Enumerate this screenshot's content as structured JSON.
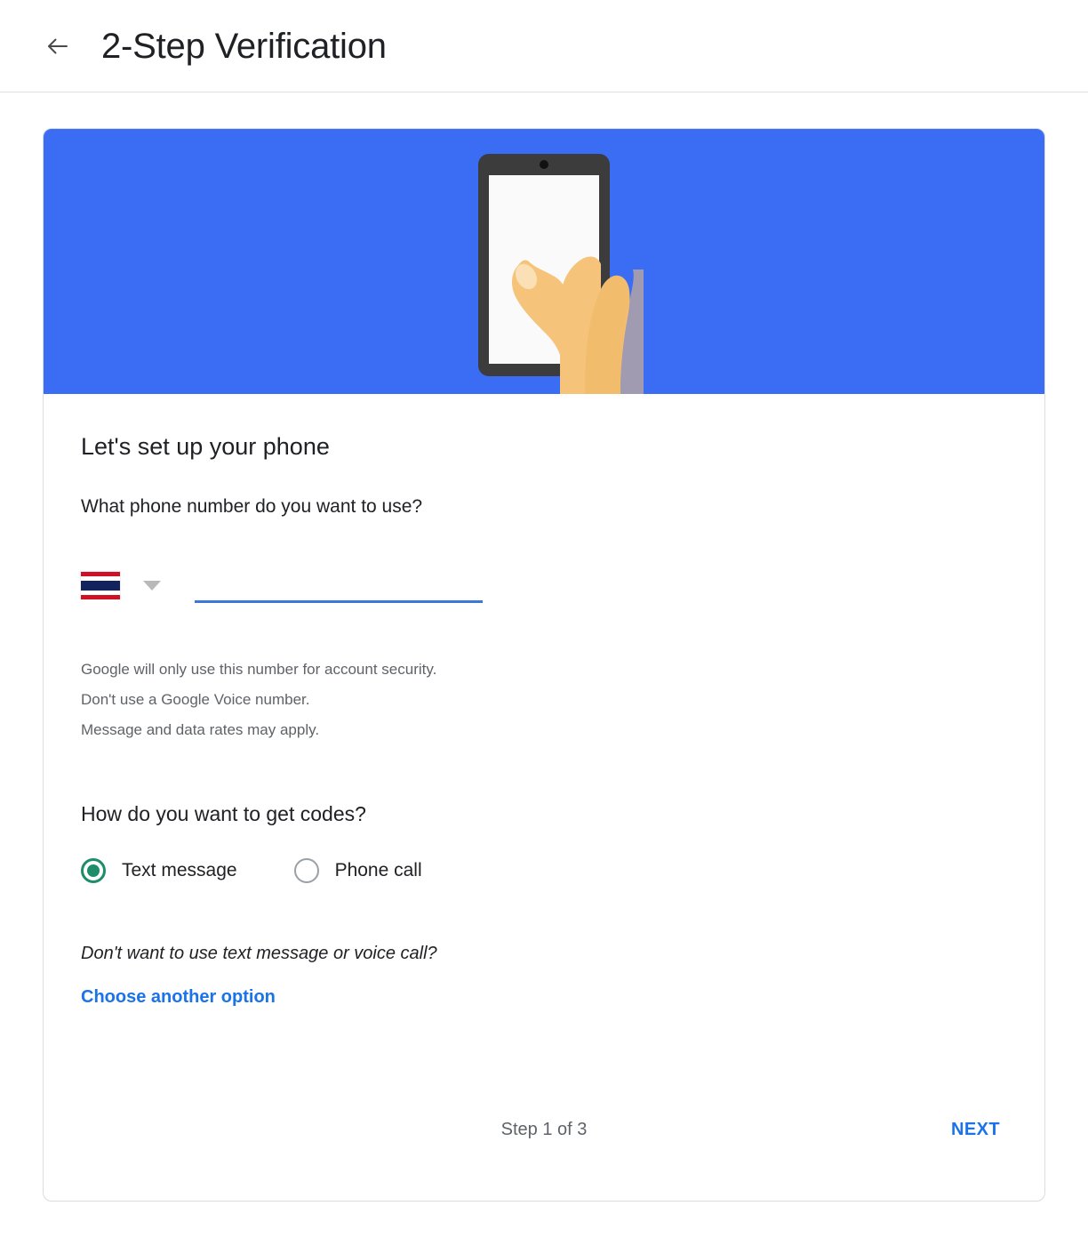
{
  "header": {
    "back_icon": "arrow-left-icon",
    "title": "2-Step Verification"
  },
  "hero": {
    "illustration_name": "hand-holding-phone-illustration",
    "background_color": "#3a6cf4",
    "phone_frame_color": "#3c3c3c",
    "phone_screen_color": "#fafafa",
    "skin_color": "#f5c37a"
  },
  "main": {
    "section_title": "Let's set up your phone",
    "phone_question": "What phone number do you want to use?",
    "country": {
      "flag_icon": "thailand-flag-icon",
      "caret_icon": "chevron-down-icon",
      "colors": {
        "red": "#cf1126",
        "white": "#ffffff",
        "navy": "#12235e"
      }
    },
    "phone_input": {
      "value": "",
      "placeholder": "",
      "underline_color": "#3b78d8"
    },
    "helper_lines": [
      "Google will only use this number for account security.",
      "Don't use a Google Voice number.",
      "Message and data rates may apply."
    ],
    "codes_question": "How do you want to get codes?",
    "code_options": [
      {
        "label": "Text message",
        "selected": true
      },
      {
        "label": "Phone call",
        "selected": false
      }
    ],
    "selected_radio_color": "#1e8e6a",
    "alt_question": "Don't want to use text message or voice call?",
    "alt_link_label": "Choose another option",
    "link_color": "#1a73e8"
  },
  "footer": {
    "step_text": "Step 1 of 3",
    "next_label": "NEXT"
  }
}
